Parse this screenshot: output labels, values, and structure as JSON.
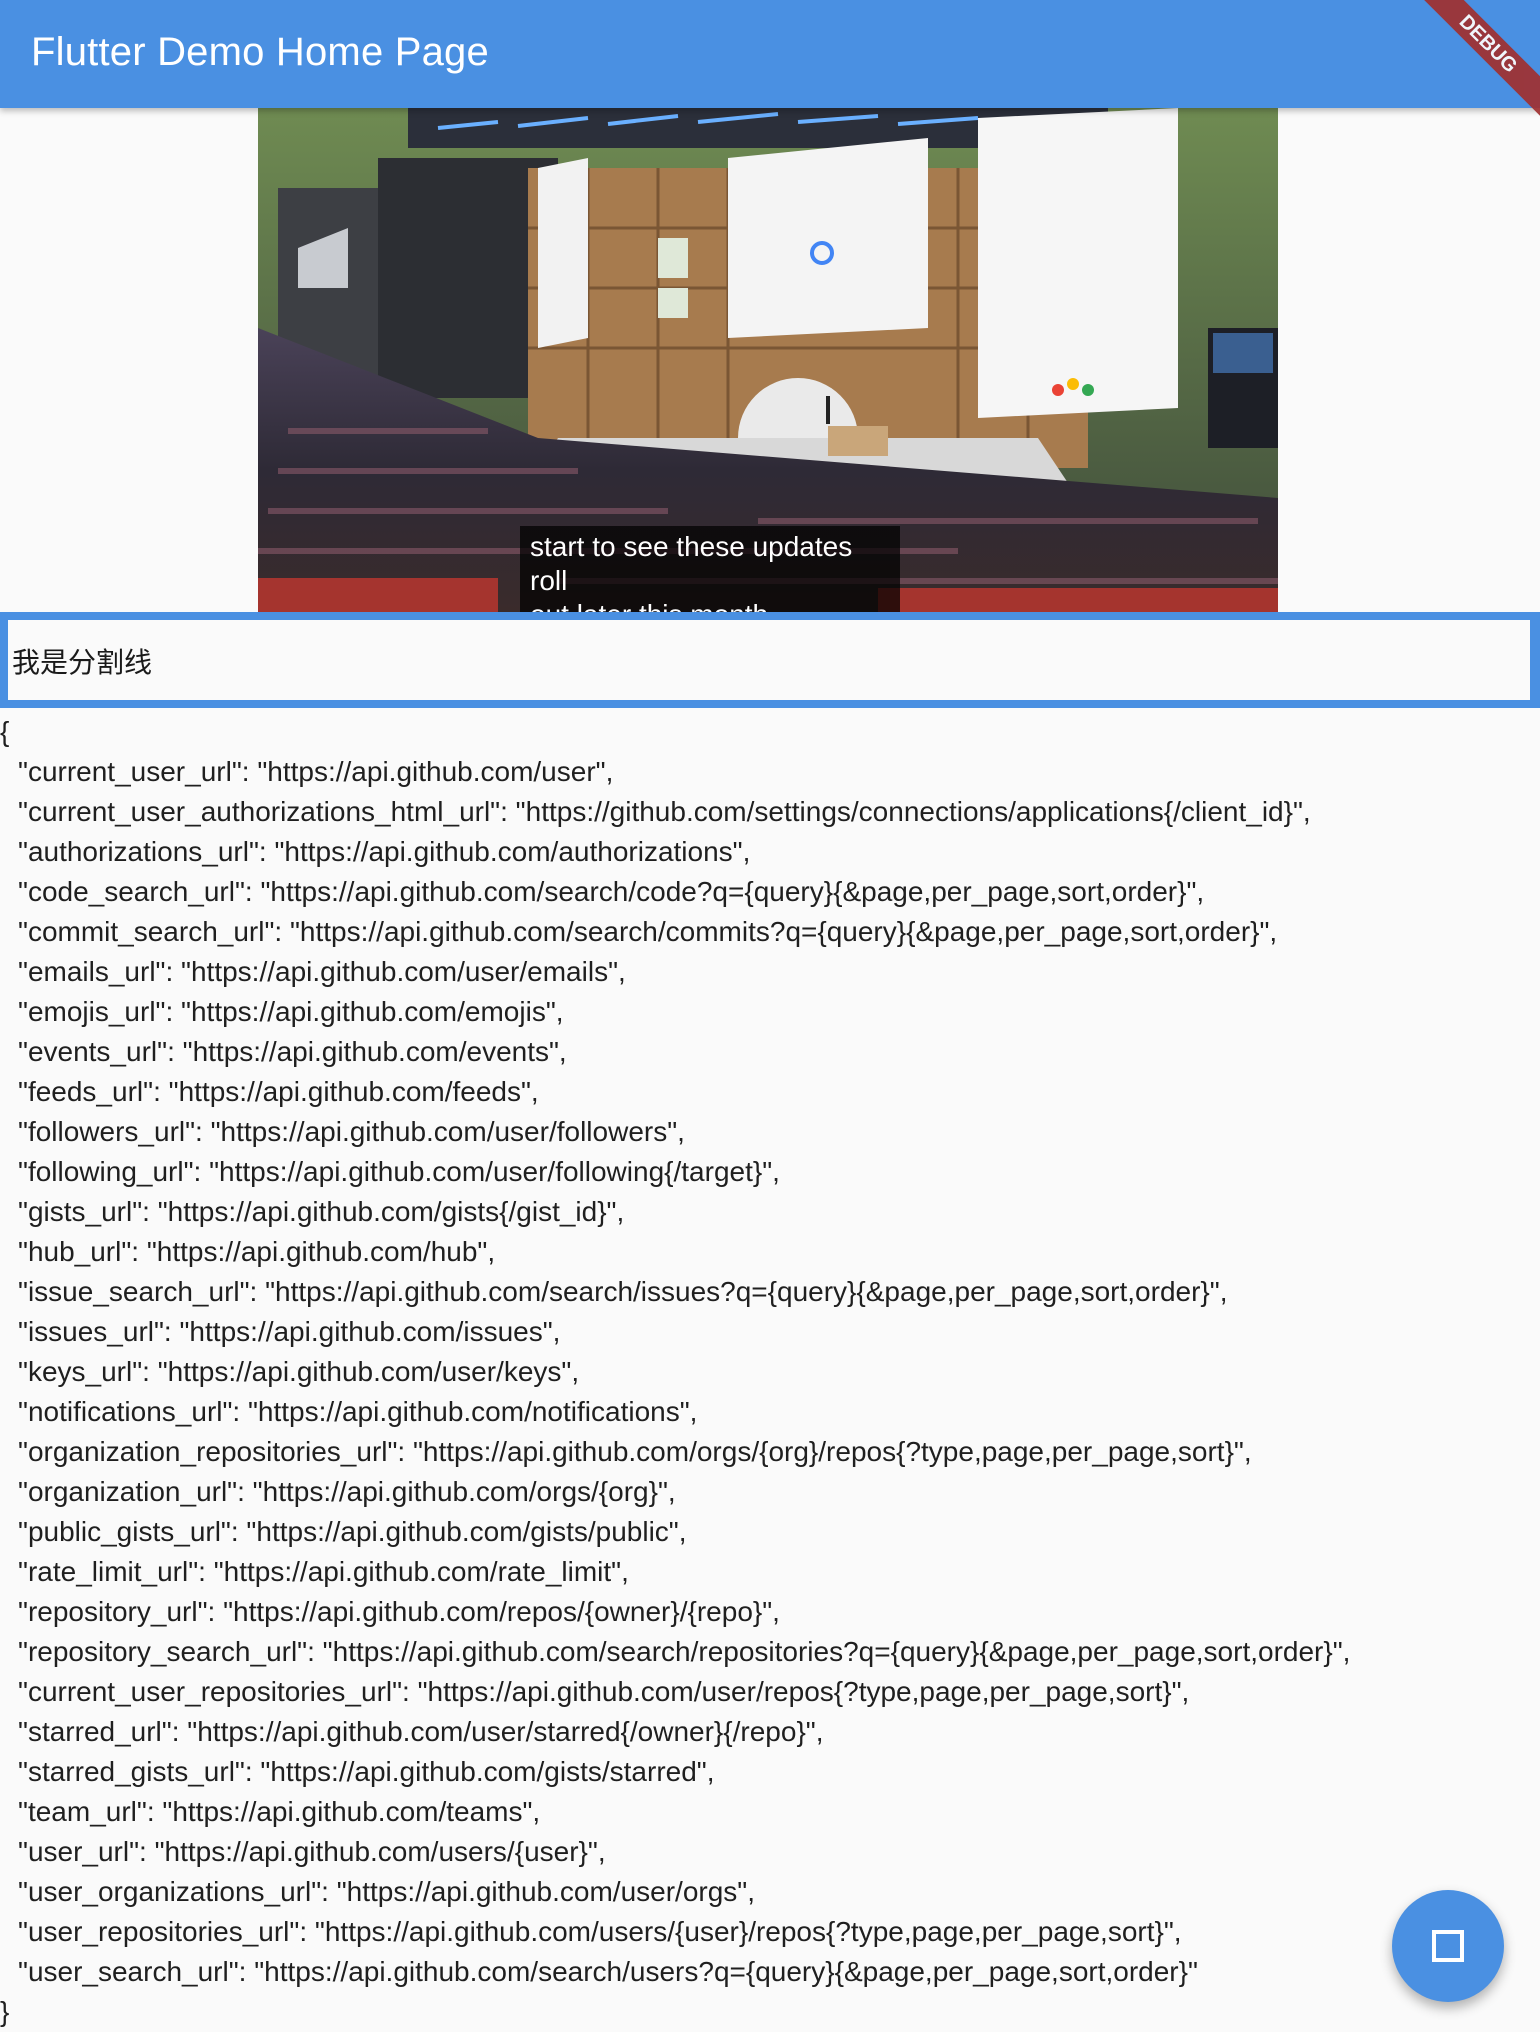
{
  "appbar": {
    "title": "Flutter Demo Home Page",
    "color": "#4a90e2"
  },
  "debug_banner": "DEBUG",
  "video": {
    "caption": "start to see these updates roll\nout later this month."
  },
  "divider": {
    "text": "我是分割线"
  },
  "json": {
    "open": "{",
    "close": "}",
    "lines": [
      "\"current_user_url\": \"https://api.github.com/user\",",
      "\"current_user_authorizations_html_url\": \"https://github.com/settings/connections/applications{/client_id}\",",
      "\"authorizations_url\": \"https://api.github.com/authorizations\",",
      "\"code_search_url\": \"https://api.github.com/search/code?q={query}{&page,per_page,sort,order}\",",
      "\"commit_search_url\": \"https://api.github.com/search/commits?q={query}{&page,per_page,sort,order}\",",
      "\"emails_url\": \"https://api.github.com/user/emails\",",
      "\"emojis_url\": \"https://api.github.com/emojis\",",
      "\"events_url\": \"https://api.github.com/events\",",
      "\"feeds_url\": \"https://api.github.com/feeds\",",
      "\"followers_url\": \"https://api.github.com/user/followers\",",
      "\"following_url\": \"https://api.github.com/user/following{/target}\",",
      "\"gists_url\": \"https://api.github.com/gists{/gist_id}\",",
      "\"hub_url\": \"https://api.github.com/hub\",",
      "\"issue_search_url\": \"https://api.github.com/search/issues?q={query}{&page,per_page,sort,order}\",",
      "\"issues_url\": \"https://api.github.com/issues\",",
      "\"keys_url\": \"https://api.github.com/user/keys\",",
      "\"notifications_url\": \"https://api.github.com/notifications\",",
      "\"organization_repositories_url\": \"https://api.github.com/orgs/{org}/repos{?type,page,per_page,sort}\",",
      "\"organization_url\": \"https://api.github.com/orgs/{org}\",",
      "\"public_gists_url\": \"https://api.github.com/gists/public\",",
      "\"rate_limit_url\": \"https://api.github.com/rate_limit\",",
      "\"repository_url\": \"https://api.github.com/repos/{owner}/{repo}\",",
      "\"repository_search_url\": \"https://api.github.com/search/repositories?q={query}{&page,per_page,sort,order}\",",
      "\"current_user_repositories_url\": \"https://api.github.com/user/repos{?type,page,per_page,sort}\",",
      "\"starred_url\": \"https://api.github.com/user/starred{/owner}{/repo}\",",
      "\"starred_gists_url\": \"https://api.github.com/gists/starred\",",
      "\"team_url\": \"https://api.github.com/teams\",",
      "\"user_url\": \"https://api.github.com/users/{user}\",",
      "\"user_organizations_url\": \"https://api.github.com/user/orgs\",",
      "\"user_repositories_url\": \"https://api.github.com/users/{user}/repos{?type,page,per_page,sort}\",",
      "\"user_search_url\": \"https://api.github.com/search/users?q={query}{&page,per_page,sort,order}\""
    ]
  },
  "fab": {
    "icon": "stop-icon"
  }
}
